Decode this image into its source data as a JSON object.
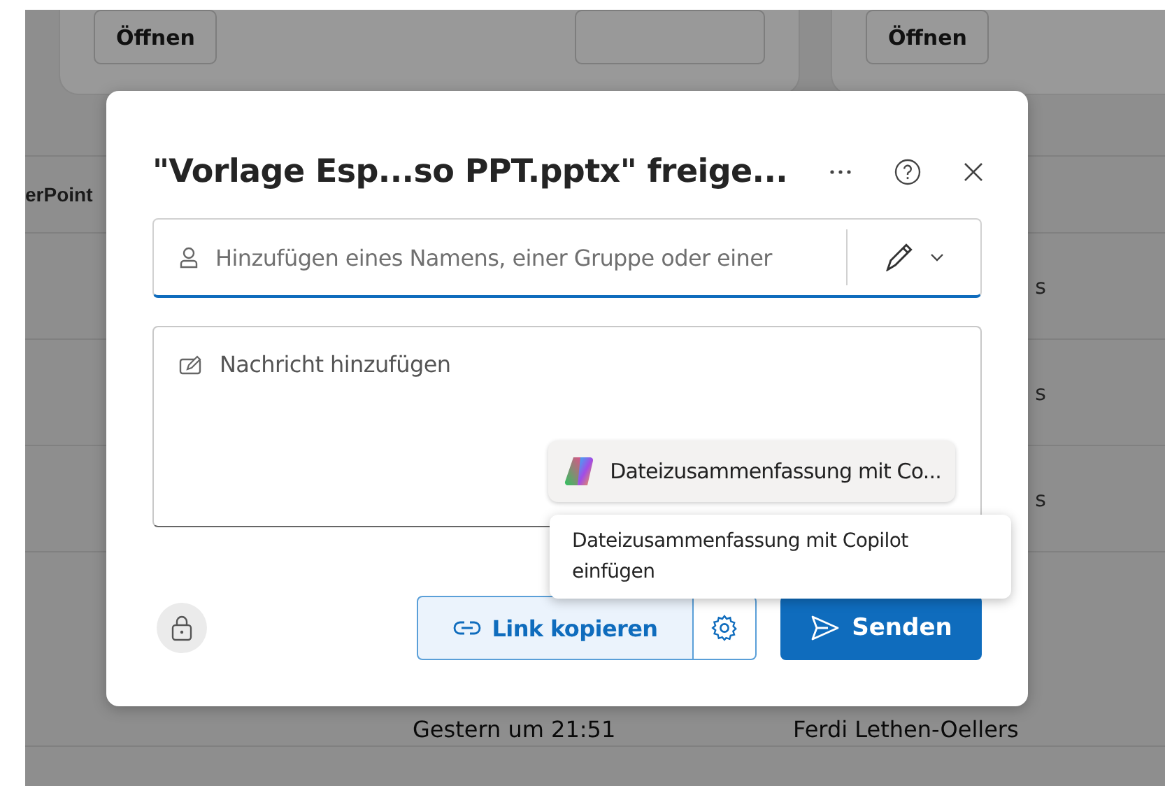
{
  "background": {
    "cards": [
      {
        "button": "Öffnen",
        "blank_button": true
      },
      {
        "button": "Öffnen",
        "blank_button": false
      }
    ],
    "side_label": "erPoint",
    "row_fragments": [
      "s",
      "s",
      "s"
    ],
    "last_row": {
      "date": "Gestern um 21:51",
      "owner": "Ferdi Lethen-Oellers"
    }
  },
  "dialog": {
    "title": "\"Vorlage Esp...so PPT.pptx\" freige...",
    "people_field": {
      "placeholder": "Hinzufügen eines Namens, einer Gruppe oder einer"
    },
    "message_field": {
      "placeholder": "Nachricht hinzufügen"
    },
    "copilot_chip": "Dateizusammenfassung mit Co...",
    "tooltip": "Dateizusammenfassung mit Copilot einfügen",
    "link_button": "Link kopieren",
    "send_button": "Senden"
  }
}
